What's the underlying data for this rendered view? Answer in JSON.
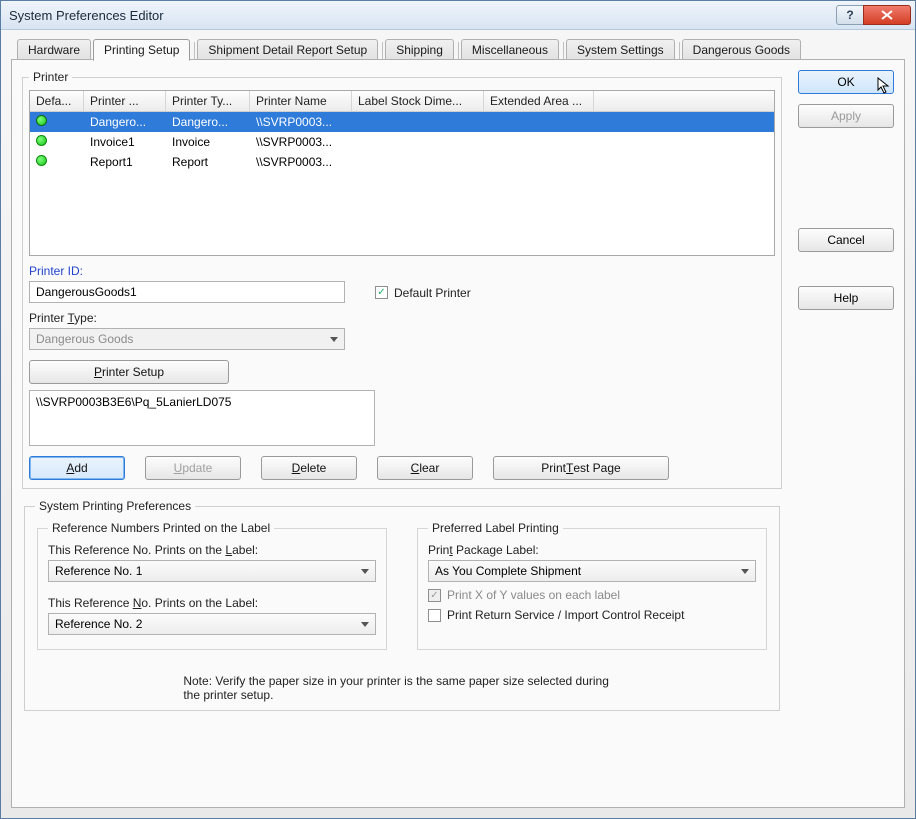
{
  "window": {
    "title": "System Preferences Editor"
  },
  "tabs": [
    "Hardware",
    "Printing Setup",
    "Shipment Detail Report Setup",
    "Shipping",
    "Miscellaneous",
    "System Settings",
    "Dangerous Goods"
  ],
  "active_tab_index": 1,
  "printer_group": {
    "legend": "Printer",
    "columns": [
      "Defa...",
      "Printer ...",
      "Printer Ty...",
      "Printer Name",
      "Label Stock Dime...",
      "Extended Area ..."
    ],
    "rows": [
      {
        "default": true,
        "printer": "Dangero...",
        "type": "Dangero...",
        "name": "\\\\SVRP0003...",
        "stock": "",
        "ext": "",
        "selected": true
      },
      {
        "default": true,
        "printer": "Invoice1",
        "type": "Invoice",
        "name": "\\\\SVRP0003...",
        "stock": "",
        "ext": "",
        "selected": false
      },
      {
        "default": true,
        "printer": "Report1",
        "type": "Report",
        "name": "\\\\SVRP0003...",
        "stock": "",
        "ext": "",
        "selected": false
      }
    ]
  },
  "form": {
    "printer_id_label": "Printer ID:",
    "printer_id_value": "DangerousGoods1",
    "default_printer_label": "Default Printer",
    "default_printer_checked": true,
    "printer_type_label": "Printer Type:",
    "printer_type_value": "Dangerous Goods",
    "printer_setup_btn": "Printer Setup",
    "printer_path": "\\\\SVRP0003B3E6\\Pq_5LanierLD075"
  },
  "buttons": {
    "add": "Add",
    "update": "Update",
    "delete": "Delete",
    "clear": "Clear",
    "print_test": "Print Test Page"
  },
  "sys_prefs": {
    "legend": "System Printing Preferences",
    "ref_legend": "Reference Numbers Printed on the Label",
    "ref1_label": "This Reference No. Prints on the Label:",
    "ref1_value": "Reference No. 1",
    "ref2_label": "This Reference No. Prints on the Label:",
    "ref2_value": "Reference No. 2",
    "pref_legend": "Preferred Label Printing",
    "pkg_label": "Print Package Label:",
    "pkg_value": "As You Complete Shipment",
    "xofy_label": "Print X of Y values on each label",
    "xofy_checked": true,
    "return_label": "Print Return Service / Import Control Receipt",
    "return_checked": false,
    "note": "Note: Verify the paper size in your printer is the same paper size selected during the printer setup."
  },
  "side": {
    "ok": "OK",
    "apply": "Apply",
    "cancel": "Cancel",
    "help": "Help"
  }
}
